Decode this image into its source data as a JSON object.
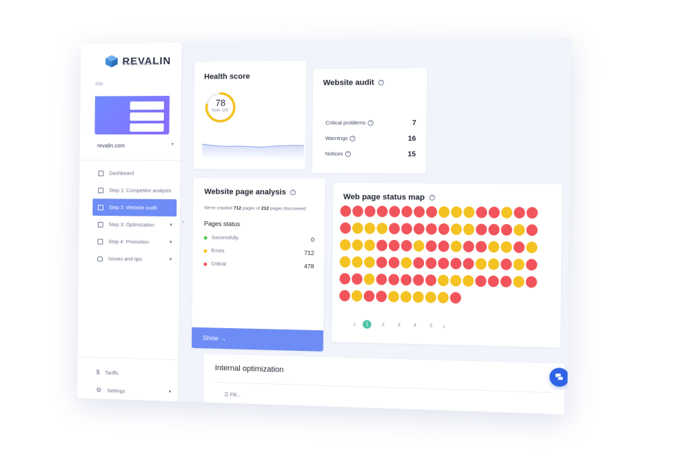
{
  "brand": {
    "name": "REVALIN",
    "tagline": "VIRTUAL ASSISTANT",
    "logo_color": "#3e8bd8"
  },
  "sidebar": {
    "site_label": "Site",
    "site_name": "revalin.com",
    "items": [
      {
        "label": "Dashboard",
        "icon": "grid-icon",
        "active": false
      },
      {
        "label": "Step 1: Competitor analysis",
        "icon": "file-icon",
        "active": false
      },
      {
        "label": "Step 2: Website audit",
        "icon": "list-icon",
        "active": true
      },
      {
        "label": "Step 3: Optimization",
        "icon": "sliders-icon",
        "active": false,
        "caret": true
      },
      {
        "label": "Step 4: Promotion",
        "icon": "chart-icon",
        "active": false,
        "caret": true
      },
      {
        "label": "Issues and tips",
        "icon": "bell-icon",
        "active": false,
        "caret": true
      }
    ],
    "bottom": [
      {
        "label": "Tariffs",
        "icon": "dollar-icon"
      },
      {
        "label": "Settings",
        "icon": "gear-icon",
        "caret": true
      }
    ]
  },
  "health": {
    "title": "Health score",
    "value": "78",
    "sub": "from 100",
    "score_fraction": 0.78,
    "gauge_color": "#f4c222"
  },
  "audit": {
    "title": "Website audit",
    "rows": [
      {
        "label": "Critical problems",
        "value": "7"
      },
      {
        "label": "Warnings",
        "value": "16"
      },
      {
        "label": "Notices",
        "value": "15"
      }
    ]
  },
  "page_analysis": {
    "title": "Website page analysis",
    "desc_pre": "We're crawled",
    "crawled": "712",
    "desc_mid": "pages of",
    "total": "212",
    "desc_post": "pages discovered",
    "status_title": "Pages status",
    "rows": [
      {
        "label": "Successfully",
        "value": "0",
        "color": "#4fc34f"
      },
      {
        "label": "Errors",
        "value": "712",
        "color": "#f4c222"
      },
      {
        "label": "Critical",
        "value": "478",
        "color": "#f2545b"
      }
    ],
    "show_label": "Show →"
  },
  "status_map": {
    "title": "Web page status map",
    "colors": {
      "r": "#f2545b",
      "y": "#f4c222"
    },
    "rows": [
      "rrrrrrrryyyrryrr",
      "ryyyrrrrryyrrryr",
      "yyyrrryrryrryyry",
      "yyyrryrrrrryyryr",
      "rryrrrrryyyrrryr",
      "ryrryyyyyr"
    ],
    "pages": [
      "1",
      "2",
      "3",
      "4",
      "5"
    ],
    "active_page": "1",
    "prev": "‹",
    "next": "›"
  },
  "internal": {
    "title": "Internal optimization",
    "filter": "Filt..."
  },
  "chat": {
    "icon": "chat-icon"
  }
}
